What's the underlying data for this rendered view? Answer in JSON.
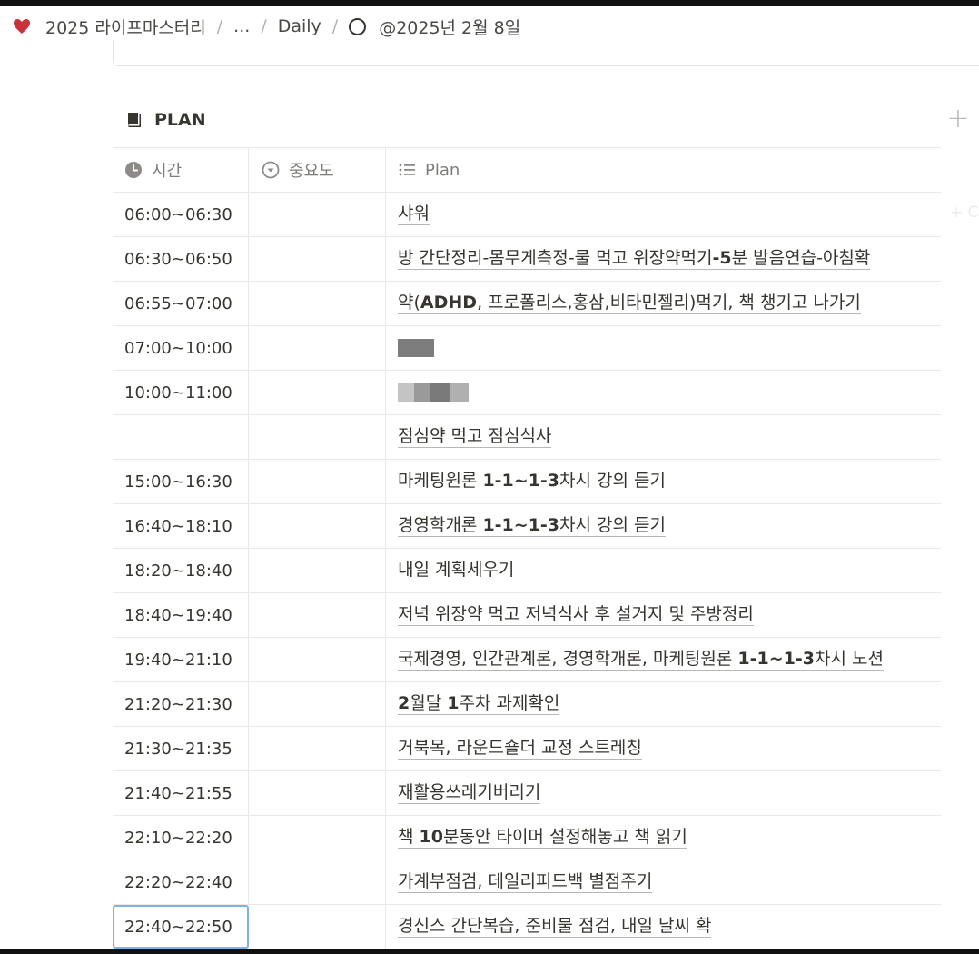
{
  "breadcrumb": {
    "workspace": "2025 라이프마스터리",
    "ellipsis": "...",
    "section": "Daily",
    "page": "@2025년 2월 8일"
  },
  "database": {
    "title": "PLAN",
    "add_symbol": "+",
    "columns": {
      "time": "시간",
      "priority": "중요도",
      "plan": "Plan"
    }
  },
  "rows": [
    {
      "time": "06:00~06:30",
      "plan": "샤워"
    },
    {
      "time": "06:30~06:50",
      "plan": "방 간단정리-몸무게측정-물 먹고 위장약먹기-5분 발음연습-아침확"
    },
    {
      "time": "06:55~07:00",
      "plan": "약(ADHD, 프로폴리스,홍삼,비타민젤리)먹기, 책 챙기고 나가기"
    },
    {
      "time": "07:00~10:00",
      "plan": ""
    },
    {
      "time": "10:00~11:00",
      "plan": ""
    },
    {
      "time": "",
      "plan": "점심약 먹고 점심식사"
    },
    {
      "time": "15:00~16:30",
      "plan": "마케팅원론 1-1~1-3차시 강의 듣기"
    },
    {
      "time": "16:40~18:10",
      "plan": "경영학개론 1-1~1-3차시 강의 듣기"
    },
    {
      "time": "18:20~18:40",
      "plan": "내일 계획세우기"
    },
    {
      "time": "18:40~19:40",
      "plan": "저녁 위장약 먹고 저녁식사 후 설거지 및 주방정리"
    },
    {
      "time": "19:40~21:10",
      "plan": "국제경영, 인간관계론, 경영학개론, 마케팅원론 1-1~1-3차시 노션"
    },
    {
      "time": "21:20~21:30",
      "plan": "2월달 1주차 과제확인"
    },
    {
      "time": "21:30~21:35",
      "plan": "거북목, 라운드숄더 교정 스트레칭"
    },
    {
      "time": "21:40~21:55",
      "plan": "재활용쓰레기버리기"
    },
    {
      "time": "22:10~22:20",
      "plan": "책 10분동안 타이머 설정해놓고 책 읽기"
    },
    {
      "time": "22:20~22:40",
      "plan": "가계부점검, 데일리피드백 별점주기"
    },
    {
      "time": "22:40~22:50",
      "plan": "경신스 간단복습, 준비물 점검, 내일 날씨 확"
    }
  ],
  "colors": {
    "heart": "#c8323a",
    "selected_outline": "#7fb2e5"
  },
  "icons": {
    "breadcrumb_workspace": "heart-icon",
    "breadcrumb_page": "circle-icon",
    "title": "book-icon",
    "time_column": "clock-icon",
    "priority_column": "select-icon",
    "plan_column": "list-icon"
  }
}
